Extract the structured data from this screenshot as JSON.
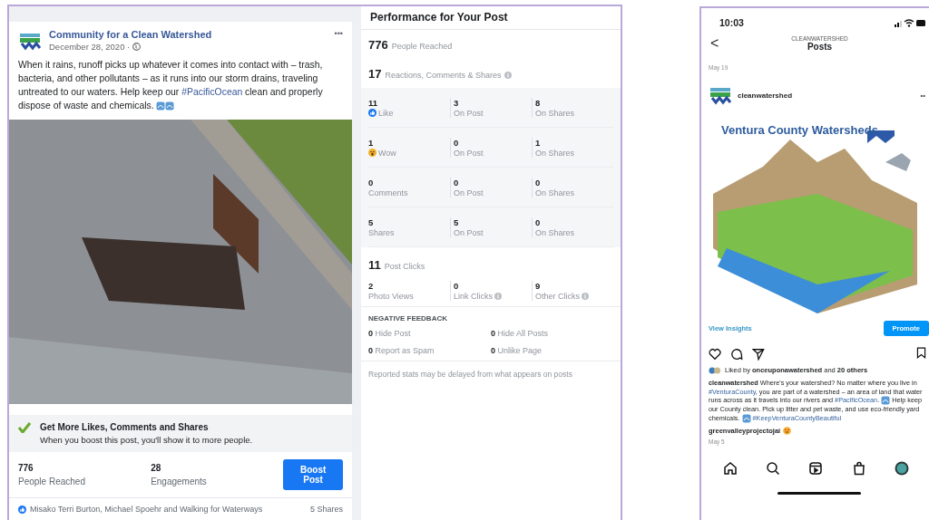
{
  "facebook_post": {
    "page_name": "Community for a Clean Watershed",
    "date": "December 28, 2020 ·",
    "menu": "•••",
    "body": [
      {
        "kind": "text",
        "text": "When it rains, runoff picks up whatever it comes into contact with – trash, bacteria, and other pollutants – as it runs into our storm drains, traveling untreated to our waters. Help keep our "
      },
      {
        "kind": "tag",
        "text": "#PacificOcean"
      },
      {
        "kind": "text",
        "text": " clean and properly dispose of waste and chemicals. "
      },
      {
        "kind": "icon"
      },
      {
        "kind": "icon"
      }
    ],
    "promo": {
      "title": "Get More Likes, Comments and Shares",
      "text": "When you boost this post, you'll show it to more people."
    },
    "stats": [
      {
        "value": "776",
        "label": "People Reached"
      },
      {
        "value": "28",
        "label": "Engagements"
      }
    ],
    "boost_button": "Boost Post",
    "reactions_text": "Misako Terri Burton, Michael Spoehr and Walking for Waterways",
    "shares": "5 Shares"
  },
  "performance": {
    "title": "Performance for Your Post",
    "reached": {
      "value": "776",
      "label": "People Reached",
      "info": false
    },
    "engagement": {
      "value": "17",
      "label": "Reactions, Comments & Shares",
      "info": true
    },
    "rows": [
      {
        "cells": [
          {
            "value": "11",
            "label": "Like",
            "kind": "like"
          },
          {
            "value": "3",
            "label": "On Post",
            "kind": "plain"
          },
          {
            "value": "8",
            "label": "On Shares",
            "kind": "plain"
          }
        ]
      },
      {
        "cells": [
          {
            "value": "1",
            "label": "Wow",
            "kind": "wow"
          },
          {
            "value": "0",
            "label": "On Post",
            "kind": "plain"
          },
          {
            "value": "1",
            "label": "On Shares",
            "kind": "plain"
          }
        ]
      },
      {
        "cells": [
          {
            "value": "0",
            "label": "Comments",
            "kind": "plain"
          },
          {
            "value": "0",
            "label": "On Post",
            "kind": "plain"
          },
          {
            "value": "0",
            "label": "On Shares",
            "kind": "plain"
          }
        ]
      },
      {
        "cells": [
          {
            "value": "5",
            "label": "Shares",
            "kind": "plain"
          },
          {
            "value": "5",
            "label": "On Post",
            "kind": "plain"
          },
          {
            "value": "0",
            "label": "On Shares",
            "kind": "plain"
          }
        ]
      }
    ],
    "clicks": {
      "value": "11",
      "label": "Post Clicks",
      "info": false
    },
    "click_cells": [
      {
        "value": "2",
        "label": "Photo Views",
        "info": false
      },
      {
        "value": "0",
        "label": "Link Clicks",
        "info": true
      },
      {
        "value": "9",
        "label": "Other Clicks",
        "info": true
      }
    ],
    "negative": {
      "title": "NEGATIVE FEEDBACK",
      "items": [
        {
          "value": "0",
          "label": "Hide Post"
        },
        {
          "value": "0",
          "label": "Hide All Posts"
        },
        {
          "value": "0",
          "label": "Report as Spam"
        },
        {
          "value": "0",
          "label": "Unlike Page"
        }
      ]
    },
    "note": "Reported stats may be delayed from what appears on posts"
  },
  "instagram": {
    "time": "10:03",
    "back": "<",
    "account": "CLEANWATERSHED",
    "title": "Posts",
    "previous_date": "May 19",
    "user": "cleanwatershed",
    "menu": "••",
    "image_title": "Ventura County Watersheds",
    "view_insights": "View Insights",
    "promote": "Promote",
    "liked_by": "Liked by **onceuponawatershed** and **20 others**",
    "caption": [
      {
        "kind": "user",
        "text": "cleanwatershed"
      },
      {
        "kind": "text",
        "text": " Where's your watershed? No matter where you live in "
      },
      {
        "kind": "tag",
        "text": "#VenturaCounty"
      },
      {
        "kind": "text",
        "text": ", you are part of a watershed – an area of land that water runs across as it travels into our rivers and "
      },
      {
        "kind": "tag",
        "text": "#PacificOcean"
      },
      {
        "kind": "text",
        "text": ". "
      },
      {
        "kind": "icon"
      },
      {
        "kind": "text",
        "text": " Help keep our County clean. Pick up litter and pet waste, and use eco-friendly yard chemicals. "
      },
      {
        "kind": "icon"
      },
      {
        "kind": "tag",
        "text": " #KeepVenturaCountyBeautiful"
      }
    ],
    "comment_user": "greenvalleyprojectojai",
    "date": "May 5"
  }
}
